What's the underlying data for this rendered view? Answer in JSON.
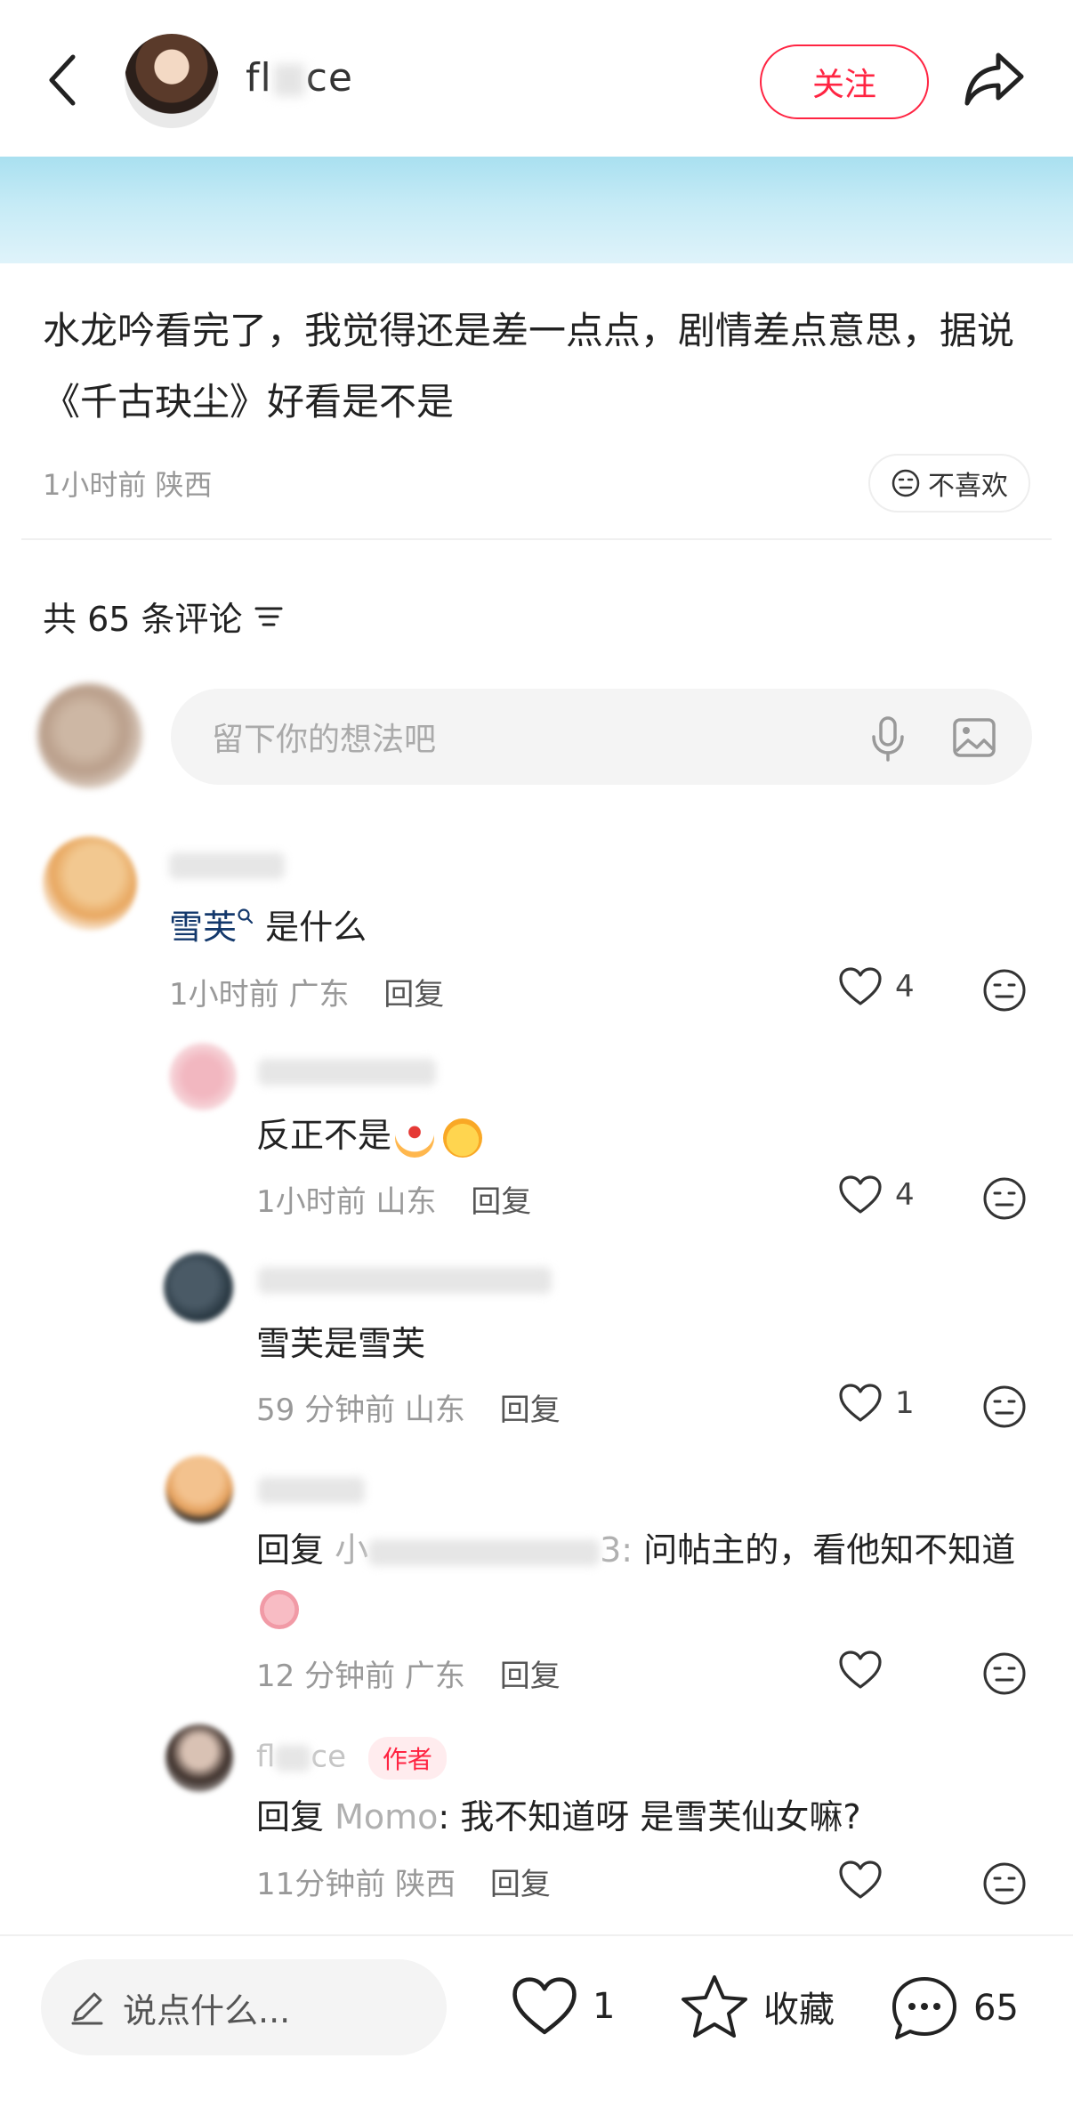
{
  "header": {
    "username": "fl",
    "username_tail": "ce",
    "follow_label": "关注"
  },
  "post": {
    "text": "水龙吟看完了，我觉得还是差一点点，剧情差点意思，据说《千古玦尘》好看是不是",
    "time": "1小时前",
    "location": "陕西",
    "dislike_label": "不喜欢"
  },
  "comments_header": {
    "label": "共 65 条评论"
  },
  "comment_input": {
    "placeholder": "留下你的想法吧"
  },
  "comments": [
    {
      "text_link": "雪芙",
      "text_rest": " 是什么",
      "time": "1小时前",
      "location": "广东",
      "reply_label": "回复",
      "likes": "4"
    },
    {
      "text": "反正不是",
      "time": "1小时前",
      "location": "山东",
      "reply_label": "回复",
      "likes": "4"
    },
    {
      "text": "雪芙是雪芙",
      "time": "59 分钟前",
      "location": "山东",
      "reply_label": "回复",
      "likes": "1"
    },
    {
      "reply_prefix": "回复",
      "reply_target_visible": "小",
      "reply_target_tail": "3:",
      "text": " 问帖主的，看他知不知道",
      "time": "12 分钟前",
      "location": "广东",
      "reply_label": "回复",
      "likes": ""
    },
    {
      "name": "fl",
      "name_tail": "ce",
      "author_tag": "作者",
      "reply_prefix": "回复",
      "reply_target": "Momo",
      "text": ": 我不知道呀 是雪芙仙女嘛?",
      "time": "11分钟前",
      "location": "陕西",
      "reply_label": "回复",
      "likes": ""
    }
  ],
  "bottom_bar": {
    "input_placeholder": "说点什么...",
    "like_count": "1",
    "collect_label": "收藏",
    "comment_count": "65"
  },
  "colors": {
    "brand_red": "#ff2442",
    "link_blue": "#13386c",
    "banner": "#c6ebf6"
  }
}
